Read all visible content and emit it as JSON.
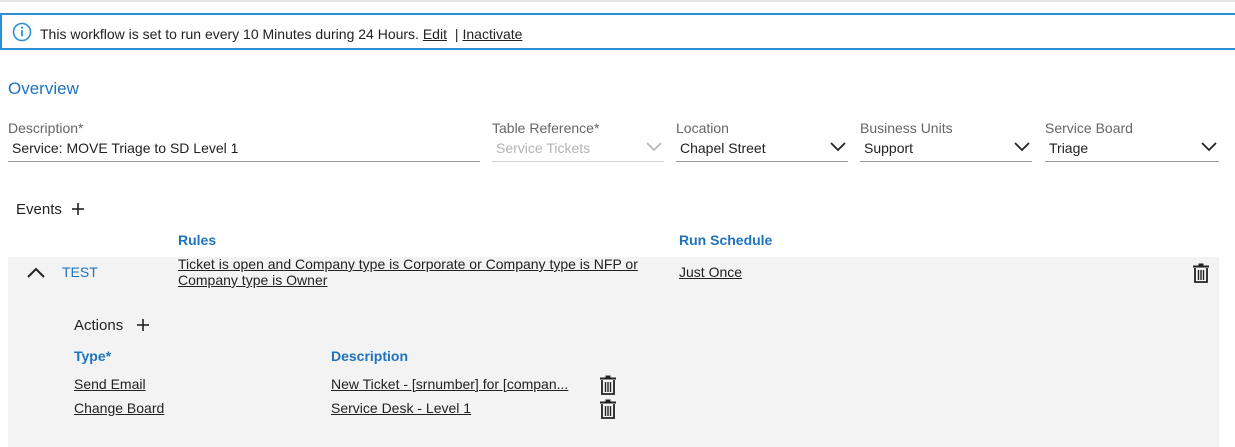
{
  "banner": {
    "message": "This workflow is set to run every 10 Minutes during 24 Hours.",
    "edit_label": "Edit",
    "separator": "|",
    "inactivate_label": "Inactivate"
  },
  "overview": {
    "title": "Overview",
    "fields": {
      "description": {
        "label": "Description*",
        "value": "Service: MOVE Triage to SD Level 1"
      },
      "table_reference": {
        "label": "Table Reference*",
        "value": "Service Tickets"
      },
      "location": {
        "label": "Location",
        "value": "Chapel Street"
      },
      "business_units": {
        "label": "Business Units",
        "value": "Support"
      },
      "service_board": {
        "label": "Service Board",
        "value": "Triage"
      }
    }
  },
  "events": {
    "title": "Events",
    "columns": {
      "rules": "Rules",
      "run_schedule": "Run Schedule"
    },
    "items": [
      {
        "name": "TEST",
        "rule": "Ticket is open and Company type is Corporate or Company type is NFP or Company type is Owner",
        "schedule": "Just Once",
        "actions": {
          "title": "Actions",
          "columns": {
            "type": "Type*",
            "description": "Description"
          },
          "rows": [
            {
              "type": "Send Email",
              "description": "New Ticket - [srnumber] for [compan..."
            },
            {
              "type": "Change Board",
              "description": "Service Desk - Level 1"
            }
          ]
        }
      }
    ]
  },
  "colors": {
    "accent": "#1e73be",
    "banner_border": "#2b8fd6",
    "panel_bg": "#f3f3f3"
  },
  "icons": [
    "info-icon",
    "chevron-down-icon",
    "plus-icon",
    "chevron-up-icon",
    "trash-icon"
  ]
}
